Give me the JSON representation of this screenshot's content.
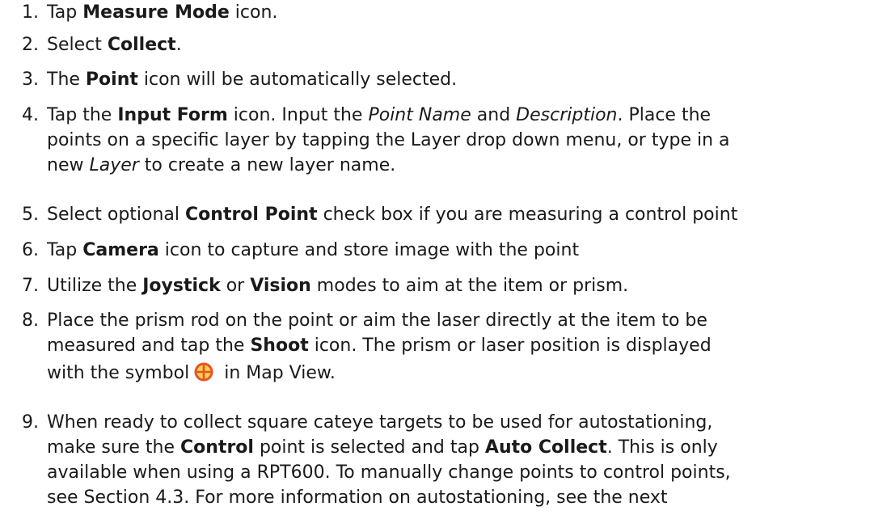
{
  "steps": [
    {
      "num": "1.",
      "p1": "Tap ",
      "b1": "Measure Mode",
      "p2": " icon."
    },
    {
      "num": "2.",
      "p1": "Select ",
      "b1": "Collect",
      "p2": "."
    },
    {
      "num": "3.",
      "p1": "The ",
      "b1": "Point",
      "p2": " icon will be automatically selected."
    },
    {
      "num": "4.",
      "p1": "Tap the ",
      "b1": "Input Form",
      "p2": " icon.  Input the ",
      "i1": "Point Name",
      "p3": " and ",
      "i2": "Description",
      "p4": ".  Place the",
      "p5": "points on a specific layer by tapping the Layer drop down menu, or type in a",
      "p6": "new ",
      "i3": "Layer",
      "p7": " to create a new layer name."
    },
    {
      "num": "5.",
      "p1": "Select optional ",
      "b1": "Control Point",
      "p2": " check box if you are measuring a control point"
    },
    {
      "num": "6.",
      "p1": "Tap ",
      "b1": "Camera",
      "p2": " icon to capture and store image with the point"
    },
    {
      "num": "7.",
      "p1": "Utilize the ",
      "b1": "Joystick",
      "p2": " or ",
      "b2": "Vision",
      "p3": " modes to aim at the item or prism."
    },
    {
      "num": "8.",
      "p1": "Place the prism rod on the point or aim the laser directly at the item to be",
      "p2": "measured and tap the ",
      "b1": "Shoot",
      "p3": " icon.  The prism or laser position is displayed",
      "p4": "with the symbol",
      "p5": " in Map View.",
      "symbol_icon": "crosshair-target-icon"
    },
    {
      "num": "9.",
      "p1": "When ready to collect square cateye targets to be used for autostationing,",
      "p2": "make sure the ",
      "b1": "Control",
      "p3": " point is selected and tap ",
      "b2": "Auto Collect",
      "p4": ".  This is only",
      "p5": "available when using a RPT600.  To manually change points to control points,",
      "p6": "see Section 4.3.  For more information on autostationing, see the next"
    }
  ],
  "colors": {
    "text": "#1a1a1a",
    "symbol_ring": "#e8532a",
    "symbol_fill": "#f6d24a"
  }
}
